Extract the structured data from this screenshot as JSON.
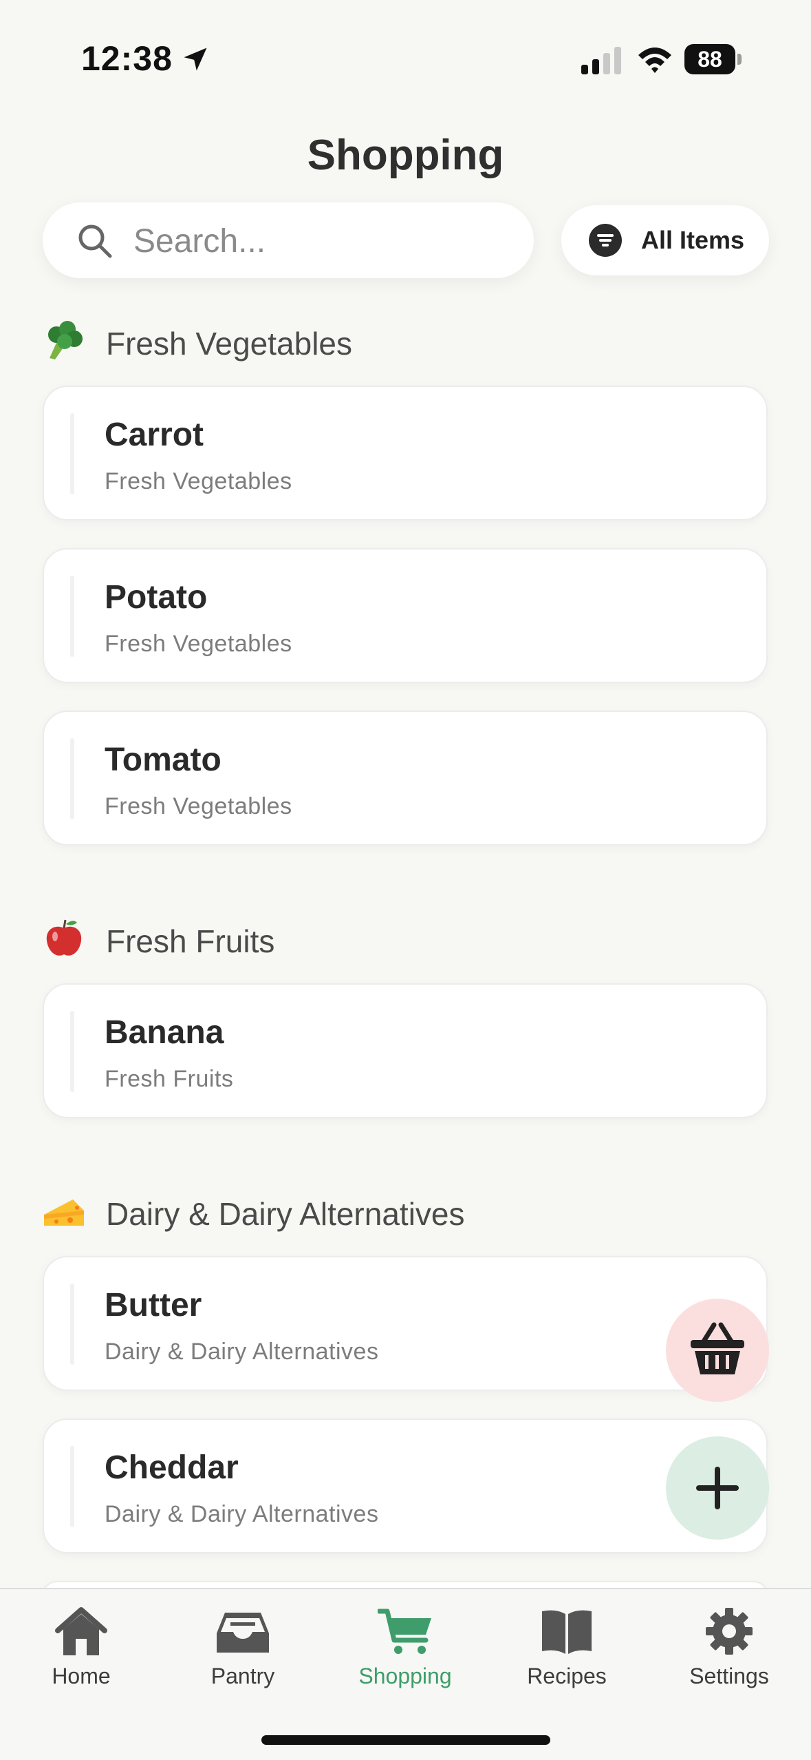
{
  "status_bar": {
    "time": "12:38",
    "battery": "88"
  },
  "header": {
    "title": "Shopping"
  },
  "search": {
    "placeholder": "Search..."
  },
  "filter": {
    "label": "All Items"
  },
  "sections": [
    {
      "emoji": "broccoli-icon",
      "title": "Fresh Vegetables",
      "items": [
        {
          "name": "Carrot",
          "category": "Fresh Vegetables"
        },
        {
          "name": "Potato",
          "category": "Fresh Vegetables"
        },
        {
          "name": "Tomato",
          "category": "Fresh Vegetables"
        }
      ]
    },
    {
      "emoji": "apple-icon",
      "title": "Fresh Fruits",
      "items": [
        {
          "name": "Banana",
          "category": "Fresh Fruits"
        }
      ]
    },
    {
      "emoji": "cheese-icon",
      "title": "Dairy & Dairy Alternatives",
      "items": [
        {
          "name": "Butter",
          "category": "Dairy & Dairy Alternatives"
        },
        {
          "name": "Cheddar",
          "category": "Dairy & Dairy Alternatives"
        }
      ]
    }
  ],
  "tabs": [
    {
      "label": "Home",
      "icon": "house-icon"
    },
    {
      "label": "Pantry",
      "icon": "inbox-tray-icon"
    },
    {
      "label": "Shopping",
      "icon": "shopping-cart-icon",
      "active": true
    },
    {
      "label": "Recipes",
      "icon": "open-book-icon"
    },
    {
      "label": "Settings",
      "icon": "gear-icon"
    }
  ],
  "colors": {
    "accent": "#3e9d6a",
    "background": "#f7f7f3",
    "basket_fab": "#fbdede",
    "add_fab": "#dcede3"
  }
}
